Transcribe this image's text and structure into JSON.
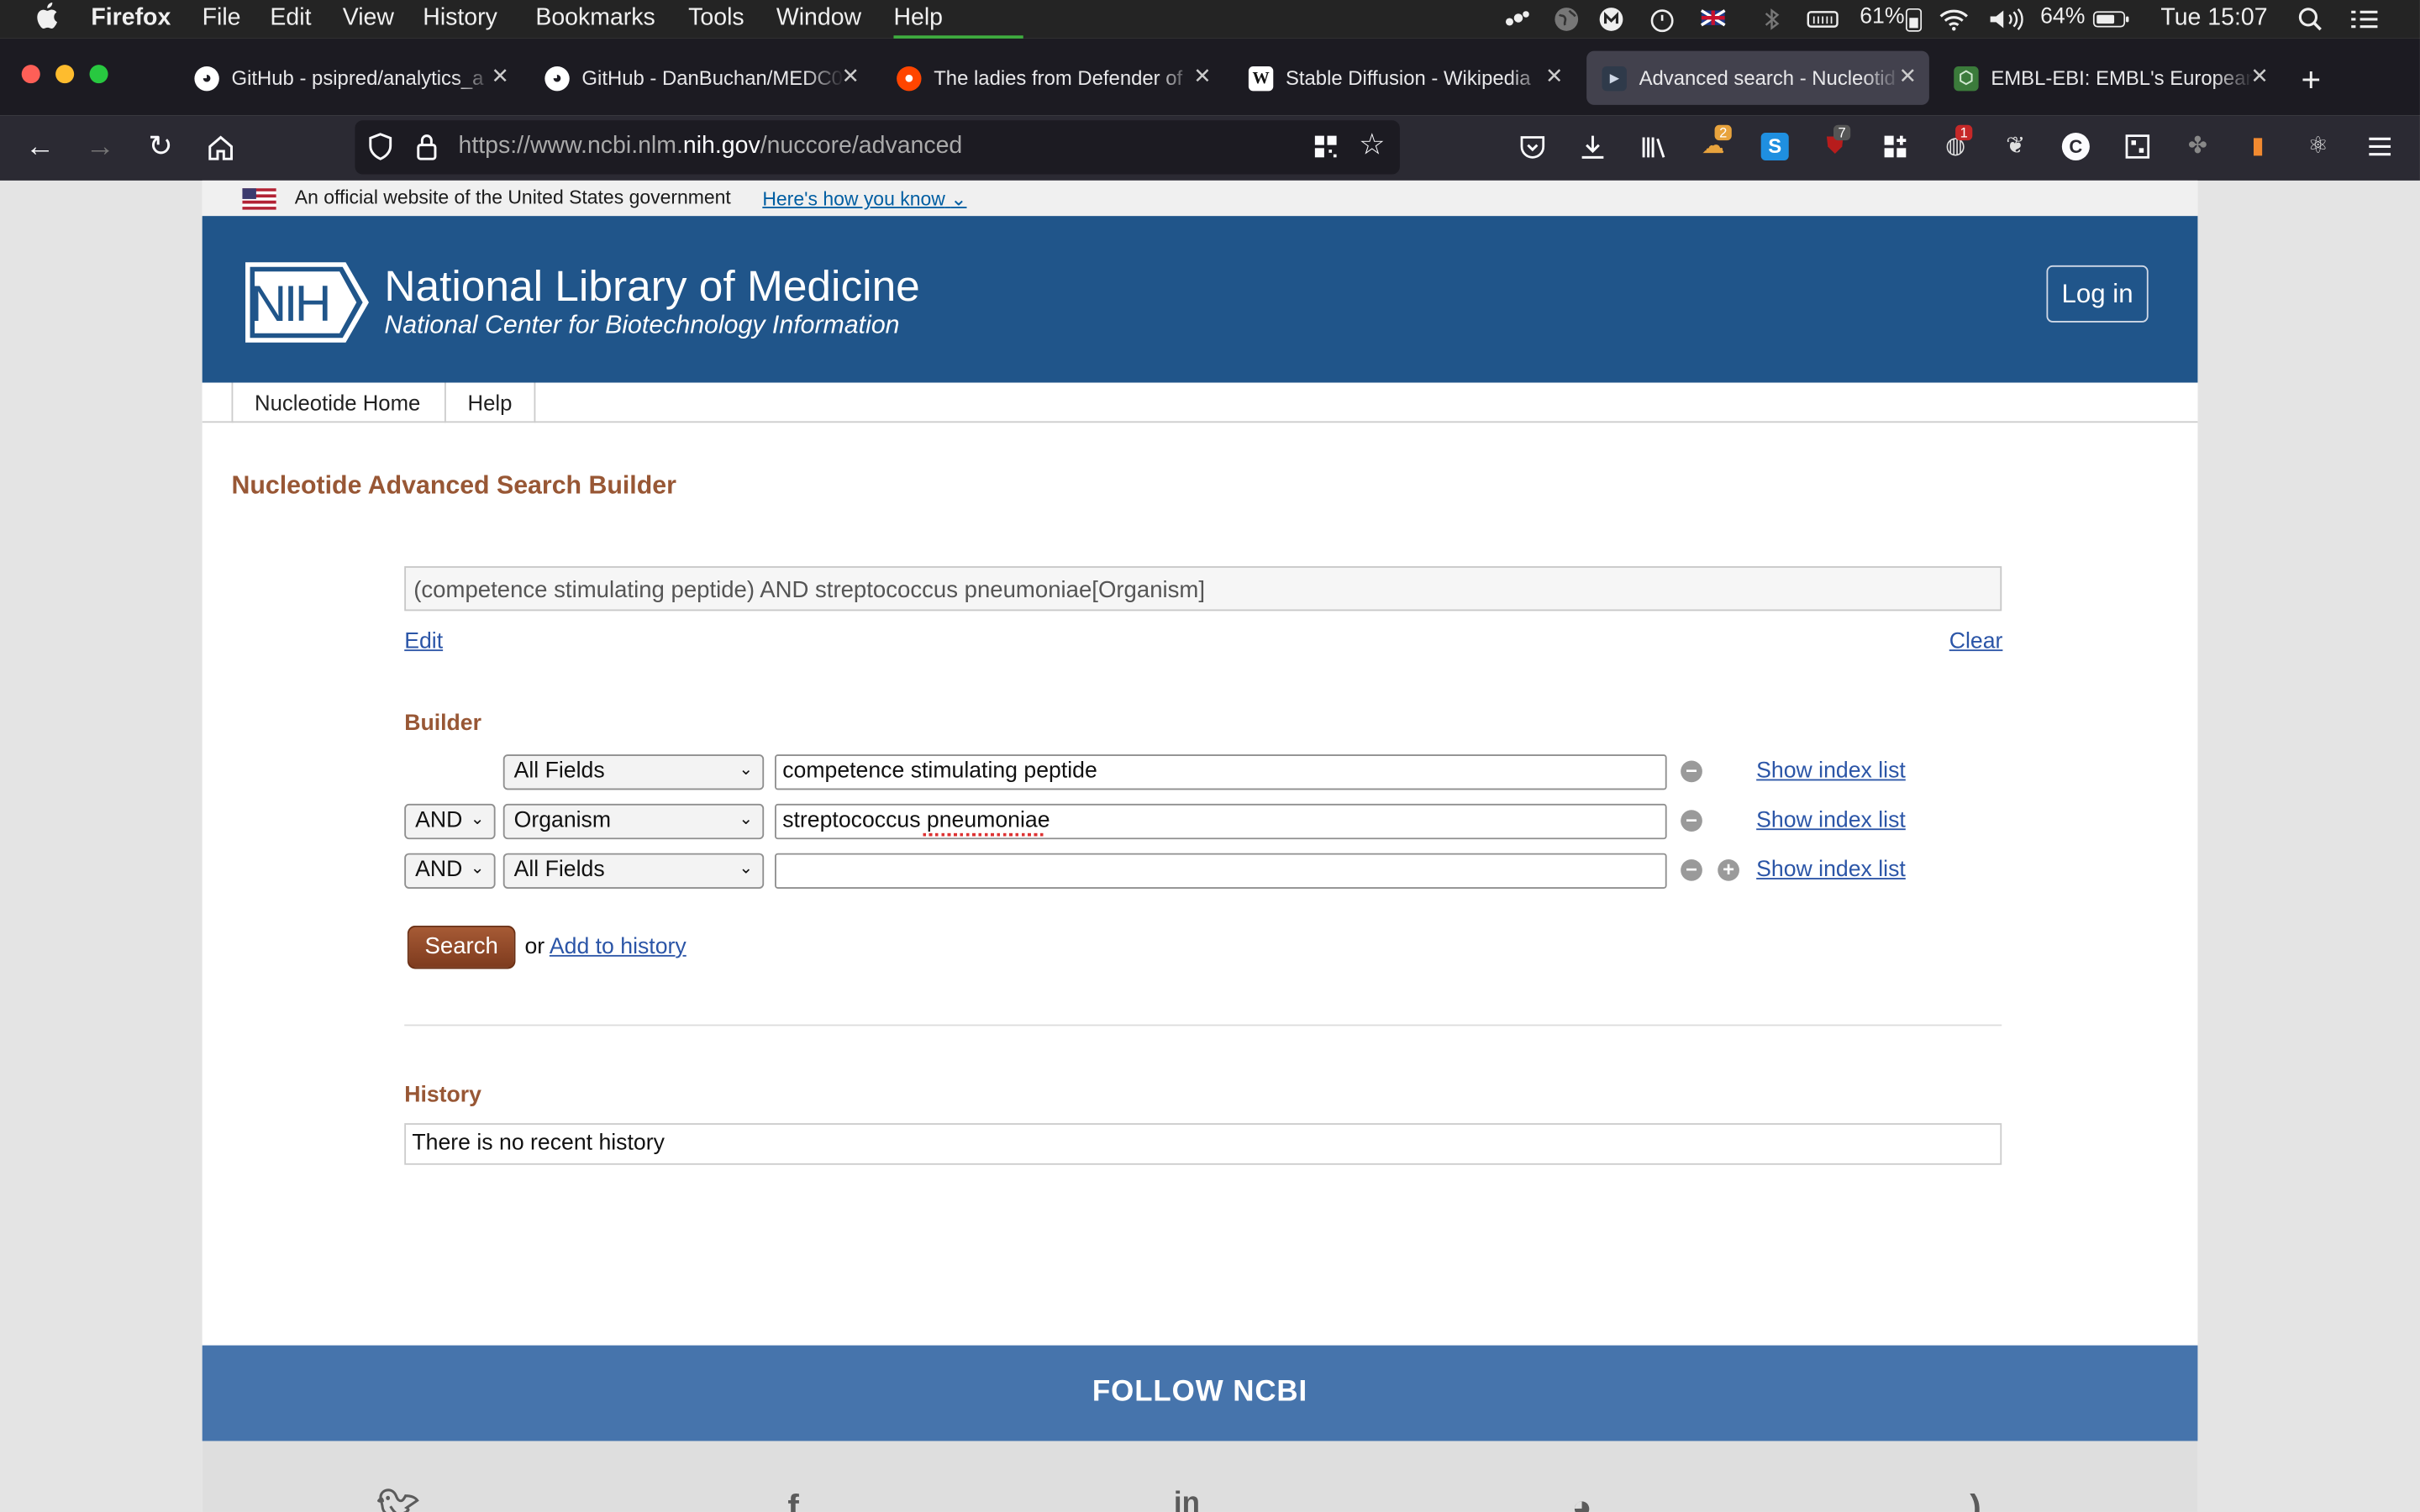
{
  "menubar": {
    "app": "Firefox",
    "items": [
      "File",
      "Edit",
      "View",
      "History",
      "Bookmarks",
      "Tools",
      "Window",
      "Help"
    ],
    "battery_ext": "61%",
    "volume": "64%",
    "clock": "Tue 15:07"
  },
  "tabs": [
    {
      "title": "GitHub - psipred/analytics_a",
      "icon": "github-icon"
    },
    {
      "title": "GitHub - DanBuchan/MEDC0",
      "icon": "github-icon"
    },
    {
      "title": "The ladies from Defender of",
      "icon": "reddit-icon"
    },
    {
      "title": "Stable Diffusion - Wikipedia",
      "icon": "wikipedia-icon"
    },
    {
      "title": "Advanced search - Nucleotid",
      "icon": "ncbi-icon",
      "active": true
    },
    {
      "title": "EMBL-EBI: EMBL's European",
      "icon": "embl-icon"
    }
  ],
  "url": {
    "prefix": "https://www.ncbi.nlm.",
    "domain": "nih.gov",
    "path": "/nuccore/advanced"
  },
  "extensions": {
    "badge_a": "2",
    "badge_b": "7",
    "badge_c": "1"
  },
  "gov_banner": {
    "text": "An official website of the United States government",
    "link": "Here's how you know"
  },
  "header": {
    "logo": "NIH",
    "title": "National Library of Medicine",
    "subtitle": "National Center for Biotechnology Information",
    "login": "Log in"
  },
  "subnav": [
    "Nucleotide Home",
    "Help"
  ],
  "page_title": "Nucleotide Advanced Search Builder",
  "query": "(competence stimulating peptide) AND streptococcus pneumoniae[Organism]",
  "edit_link": "Edit",
  "clear_link": "Clear",
  "builder": {
    "title": "Builder",
    "rows": [
      {
        "op": "",
        "field": "All Fields",
        "value": "competence stimulating peptide",
        "index": "Show index list"
      },
      {
        "op": "AND",
        "field": "Organism",
        "value": "streptococcus pneumoniae",
        "index": "Show index list"
      },
      {
        "op": "AND",
        "field": "All Fields",
        "value": "",
        "index": "Show index list"
      }
    ]
  },
  "search_button": "Search",
  "or_text": "or",
  "add_history": "Add to history",
  "history": {
    "title": "History",
    "empty": "There is no recent history"
  },
  "footer": {
    "follow": "FOLLOW NCBI"
  }
}
